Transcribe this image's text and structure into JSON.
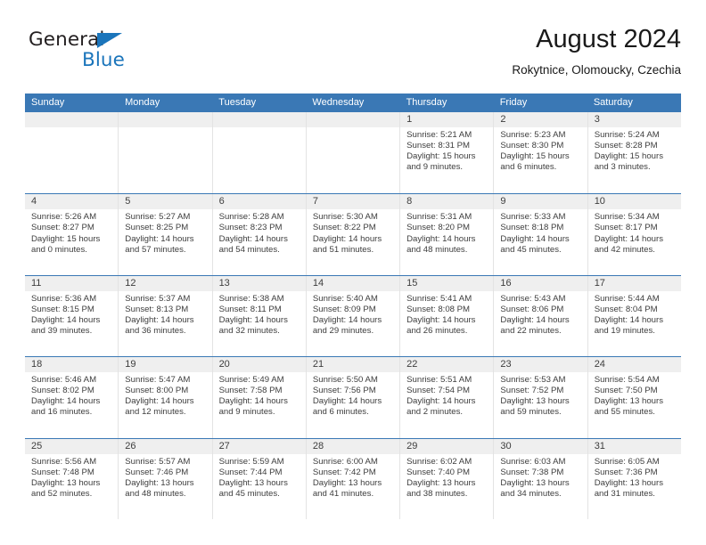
{
  "brand": {
    "name_part1": "General",
    "name_part2": "Blue",
    "triangle_color": "#1b75bb"
  },
  "header": {
    "title": "August 2024",
    "subtitle": "Rokytnice, Olomoucky, Czechia"
  },
  "calendar": {
    "header_color": "#3a78b5",
    "weekdays": [
      "Sunday",
      "Monday",
      "Tuesday",
      "Wednesday",
      "Thursday",
      "Friday",
      "Saturday"
    ],
    "weeks": [
      [
        {
          "date": "",
          "sunrise": "",
          "sunset": "",
          "daylight_line1": "",
          "daylight_line2": ""
        },
        {
          "date": "",
          "sunrise": "",
          "sunset": "",
          "daylight_line1": "",
          "daylight_line2": ""
        },
        {
          "date": "",
          "sunrise": "",
          "sunset": "",
          "daylight_line1": "",
          "daylight_line2": ""
        },
        {
          "date": "",
          "sunrise": "",
          "sunset": "",
          "daylight_line1": "",
          "daylight_line2": ""
        },
        {
          "date": "1",
          "sunrise": "Sunrise: 5:21 AM",
          "sunset": "Sunset: 8:31 PM",
          "daylight_line1": "Daylight: 15 hours",
          "daylight_line2": "and 9 minutes."
        },
        {
          "date": "2",
          "sunrise": "Sunrise: 5:23 AM",
          "sunset": "Sunset: 8:30 PM",
          "daylight_line1": "Daylight: 15 hours",
          "daylight_line2": "and 6 minutes."
        },
        {
          "date": "3",
          "sunrise": "Sunrise: 5:24 AM",
          "sunset": "Sunset: 8:28 PM",
          "daylight_line1": "Daylight: 15 hours",
          "daylight_line2": "and 3 minutes."
        }
      ],
      [
        {
          "date": "4",
          "sunrise": "Sunrise: 5:26 AM",
          "sunset": "Sunset: 8:27 PM",
          "daylight_line1": "Daylight: 15 hours",
          "daylight_line2": "and 0 minutes."
        },
        {
          "date": "5",
          "sunrise": "Sunrise: 5:27 AM",
          "sunset": "Sunset: 8:25 PM",
          "daylight_line1": "Daylight: 14 hours",
          "daylight_line2": "and 57 minutes."
        },
        {
          "date": "6",
          "sunrise": "Sunrise: 5:28 AM",
          "sunset": "Sunset: 8:23 PM",
          "daylight_line1": "Daylight: 14 hours",
          "daylight_line2": "and 54 minutes."
        },
        {
          "date": "7",
          "sunrise": "Sunrise: 5:30 AM",
          "sunset": "Sunset: 8:22 PM",
          "daylight_line1": "Daylight: 14 hours",
          "daylight_line2": "and 51 minutes."
        },
        {
          "date": "8",
          "sunrise": "Sunrise: 5:31 AM",
          "sunset": "Sunset: 8:20 PM",
          "daylight_line1": "Daylight: 14 hours",
          "daylight_line2": "and 48 minutes."
        },
        {
          "date": "9",
          "sunrise": "Sunrise: 5:33 AM",
          "sunset": "Sunset: 8:18 PM",
          "daylight_line1": "Daylight: 14 hours",
          "daylight_line2": "and 45 minutes."
        },
        {
          "date": "10",
          "sunrise": "Sunrise: 5:34 AM",
          "sunset": "Sunset: 8:17 PM",
          "daylight_line1": "Daylight: 14 hours",
          "daylight_line2": "and 42 minutes."
        }
      ],
      [
        {
          "date": "11",
          "sunrise": "Sunrise: 5:36 AM",
          "sunset": "Sunset: 8:15 PM",
          "daylight_line1": "Daylight: 14 hours",
          "daylight_line2": "and 39 minutes."
        },
        {
          "date": "12",
          "sunrise": "Sunrise: 5:37 AM",
          "sunset": "Sunset: 8:13 PM",
          "daylight_line1": "Daylight: 14 hours",
          "daylight_line2": "and 36 minutes."
        },
        {
          "date": "13",
          "sunrise": "Sunrise: 5:38 AM",
          "sunset": "Sunset: 8:11 PM",
          "daylight_line1": "Daylight: 14 hours",
          "daylight_line2": "and 32 minutes."
        },
        {
          "date": "14",
          "sunrise": "Sunrise: 5:40 AM",
          "sunset": "Sunset: 8:09 PM",
          "daylight_line1": "Daylight: 14 hours",
          "daylight_line2": "and 29 minutes."
        },
        {
          "date": "15",
          "sunrise": "Sunrise: 5:41 AM",
          "sunset": "Sunset: 8:08 PM",
          "daylight_line1": "Daylight: 14 hours",
          "daylight_line2": "and 26 minutes."
        },
        {
          "date": "16",
          "sunrise": "Sunrise: 5:43 AM",
          "sunset": "Sunset: 8:06 PM",
          "daylight_line1": "Daylight: 14 hours",
          "daylight_line2": "and 22 minutes."
        },
        {
          "date": "17",
          "sunrise": "Sunrise: 5:44 AM",
          "sunset": "Sunset: 8:04 PM",
          "daylight_line1": "Daylight: 14 hours",
          "daylight_line2": "and 19 minutes."
        }
      ],
      [
        {
          "date": "18",
          "sunrise": "Sunrise: 5:46 AM",
          "sunset": "Sunset: 8:02 PM",
          "daylight_line1": "Daylight: 14 hours",
          "daylight_line2": "and 16 minutes."
        },
        {
          "date": "19",
          "sunrise": "Sunrise: 5:47 AM",
          "sunset": "Sunset: 8:00 PM",
          "daylight_line1": "Daylight: 14 hours",
          "daylight_line2": "and 12 minutes."
        },
        {
          "date": "20",
          "sunrise": "Sunrise: 5:49 AM",
          "sunset": "Sunset: 7:58 PM",
          "daylight_line1": "Daylight: 14 hours",
          "daylight_line2": "and 9 minutes."
        },
        {
          "date": "21",
          "sunrise": "Sunrise: 5:50 AM",
          "sunset": "Sunset: 7:56 PM",
          "daylight_line1": "Daylight: 14 hours",
          "daylight_line2": "and 6 minutes."
        },
        {
          "date": "22",
          "sunrise": "Sunrise: 5:51 AM",
          "sunset": "Sunset: 7:54 PM",
          "daylight_line1": "Daylight: 14 hours",
          "daylight_line2": "and 2 minutes."
        },
        {
          "date": "23",
          "sunrise": "Sunrise: 5:53 AM",
          "sunset": "Sunset: 7:52 PM",
          "daylight_line1": "Daylight: 13 hours",
          "daylight_line2": "and 59 minutes."
        },
        {
          "date": "24",
          "sunrise": "Sunrise: 5:54 AM",
          "sunset": "Sunset: 7:50 PM",
          "daylight_line1": "Daylight: 13 hours",
          "daylight_line2": "and 55 minutes."
        }
      ],
      [
        {
          "date": "25",
          "sunrise": "Sunrise: 5:56 AM",
          "sunset": "Sunset: 7:48 PM",
          "daylight_line1": "Daylight: 13 hours",
          "daylight_line2": "and 52 minutes."
        },
        {
          "date": "26",
          "sunrise": "Sunrise: 5:57 AM",
          "sunset": "Sunset: 7:46 PM",
          "daylight_line1": "Daylight: 13 hours",
          "daylight_line2": "and 48 minutes."
        },
        {
          "date": "27",
          "sunrise": "Sunrise: 5:59 AM",
          "sunset": "Sunset: 7:44 PM",
          "daylight_line1": "Daylight: 13 hours",
          "daylight_line2": "and 45 minutes."
        },
        {
          "date": "28",
          "sunrise": "Sunrise: 6:00 AM",
          "sunset": "Sunset: 7:42 PM",
          "daylight_line1": "Daylight: 13 hours",
          "daylight_line2": "and 41 minutes."
        },
        {
          "date": "29",
          "sunrise": "Sunrise: 6:02 AM",
          "sunset": "Sunset: 7:40 PM",
          "daylight_line1": "Daylight: 13 hours",
          "daylight_line2": "and 38 minutes."
        },
        {
          "date": "30",
          "sunrise": "Sunrise: 6:03 AM",
          "sunset": "Sunset: 7:38 PM",
          "daylight_line1": "Daylight: 13 hours",
          "daylight_line2": "and 34 minutes."
        },
        {
          "date": "31",
          "sunrise": "Sunrise: 6:05 AM",
          "sunset": "Sunset: 7:36 PM",
          "daylight_line1": "Daylight: 13 hours",
          "daylight_line2": "and 31 minutes."
        }
      ]
    ]
  }
}
